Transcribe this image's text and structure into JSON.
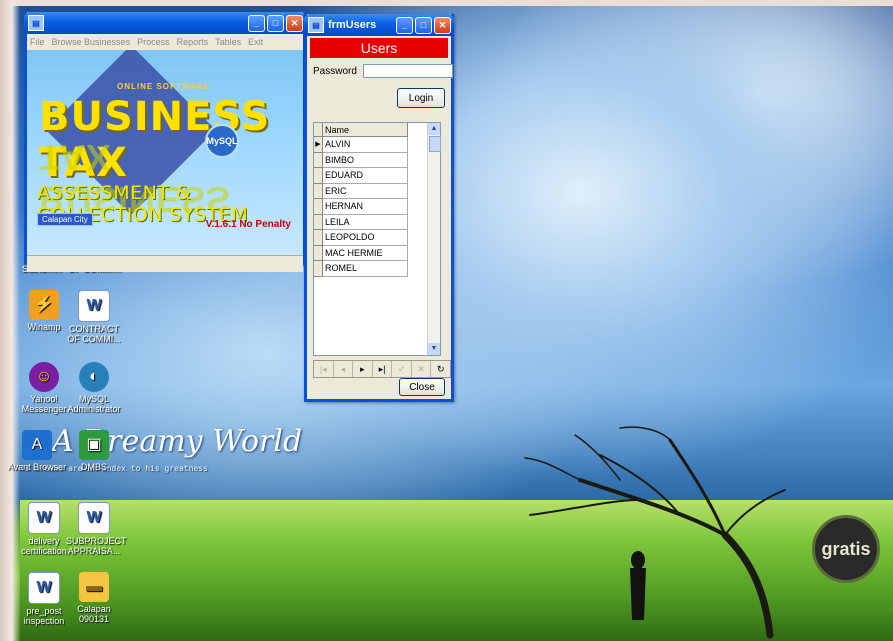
{
  "desktop": {
    "wallpaper_title": "A Dreamy World",
    "wallpaper_subtitle": "'s dreams are an index to his greatness",
    "logo_text": "gratis",
    "taskbar_items": [
      "StartSm...",
      "OF COMMI..."
    ],
    "icons": [
      {
        "label": "Winamp",
        "icon": "winamp-icon"
      },
      {
        "label": "CONTRACT OF COMMI...",
        "icon": "word-document-icon"
      },
      {
        "label": "Yahoo! Messenger",
        "icon": "yahoo-messenger-icon"
      },
      {
        "label": "MySQL Administrator",
        "icon": "mysql-icon"
      },
      {
        "label": "Avant Browser",
        "icon": "avant-browser-icon"
      },
      {
        "label": "DMBS",
        "icon": "app-icon"
      },
      {
        "label": "delivery certification",
        "icon": "word-document-icon"
      },
      {
        "label": "SUBPROJECT APPRAISA...",
        "icon": "word-document-icon"
      },
      {
        "label": "pre_post inspection",
        "icon": "word-document-icon"
      },
      {
        "label": "Calapan 090131",
        "icon": "folder-icon"
      }
    ]
  },
  "app_window": {
    "title": "",
    "menu": [
      "File",
      "Browse Businesses",
      "Process",
      "Reports",
      "Tables",
      "Exit"
    ],
    "banner": {
      "software_label": "ONLINE SOFTWARE",
      "title": "BUSINESS TAX",
      "badge": "MySQL",
      "subtitle": "ASSESSMENT & COLLECTION SYSTEM",
      "city": "Calapan City",
      "version": "V.1.6.1 No Penalty"
    }
  },
  "users_window": {
    "title": "frmUsers",
    "header": "Users",
    "password_label": "Password",
    "password_value": "",
    "login_button": "Login",
    "grid_column": "Name",
    "names": [
      "ALVIN",
      "BIMBO",
      "EDUARD",
      "ERIC",
      "HERNAN",
      "LEILA",
      "LEOPOLDO",
      "MAC HERMIE",
      "ROMEL"
    ],
    "selected_index": 0,
    "close_button": "Close"
  }
}
